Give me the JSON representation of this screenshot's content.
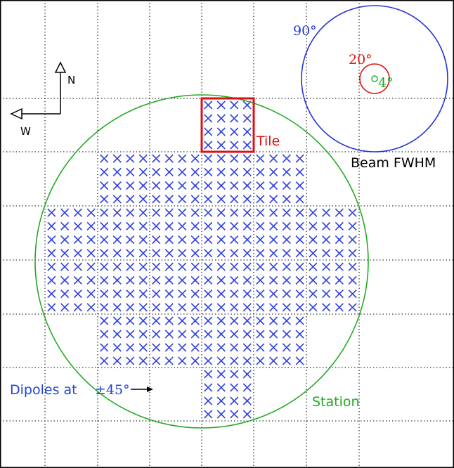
{
  "compass": {
    "north": "N",
    "west": "W"
  },
  "beams": [
    {
      "label": "90°",
      "color": "#2233dd"
    },
    {
      "label": "20°",
      "color": "#dd1111"
    },
    {
      "label": "4°",
      "color": "#22aa22"
    }
  ],
  "beam_caption": "Beam FWHM",
  "tile_label": "Tile",
  "station_label": "Station",
  "dipole_label": {
    "text": "Dipoles at",
    "angle": "±45°"
  },
  "colors": {
    "dipole": "#3344dd",
    "tile": "#dd1111",
    "station": "#22aa22",
    "grid": "#000000"
  },
  "layout": {
    "tiles_per_row": [
      1,
      4,
      6,
      6,
      4,
      1
    ],
    "dipoles_per_tile_side": 4,
    "highlighted_tile": {
      "row": 0,
      "col": 0
    }
  }
}
